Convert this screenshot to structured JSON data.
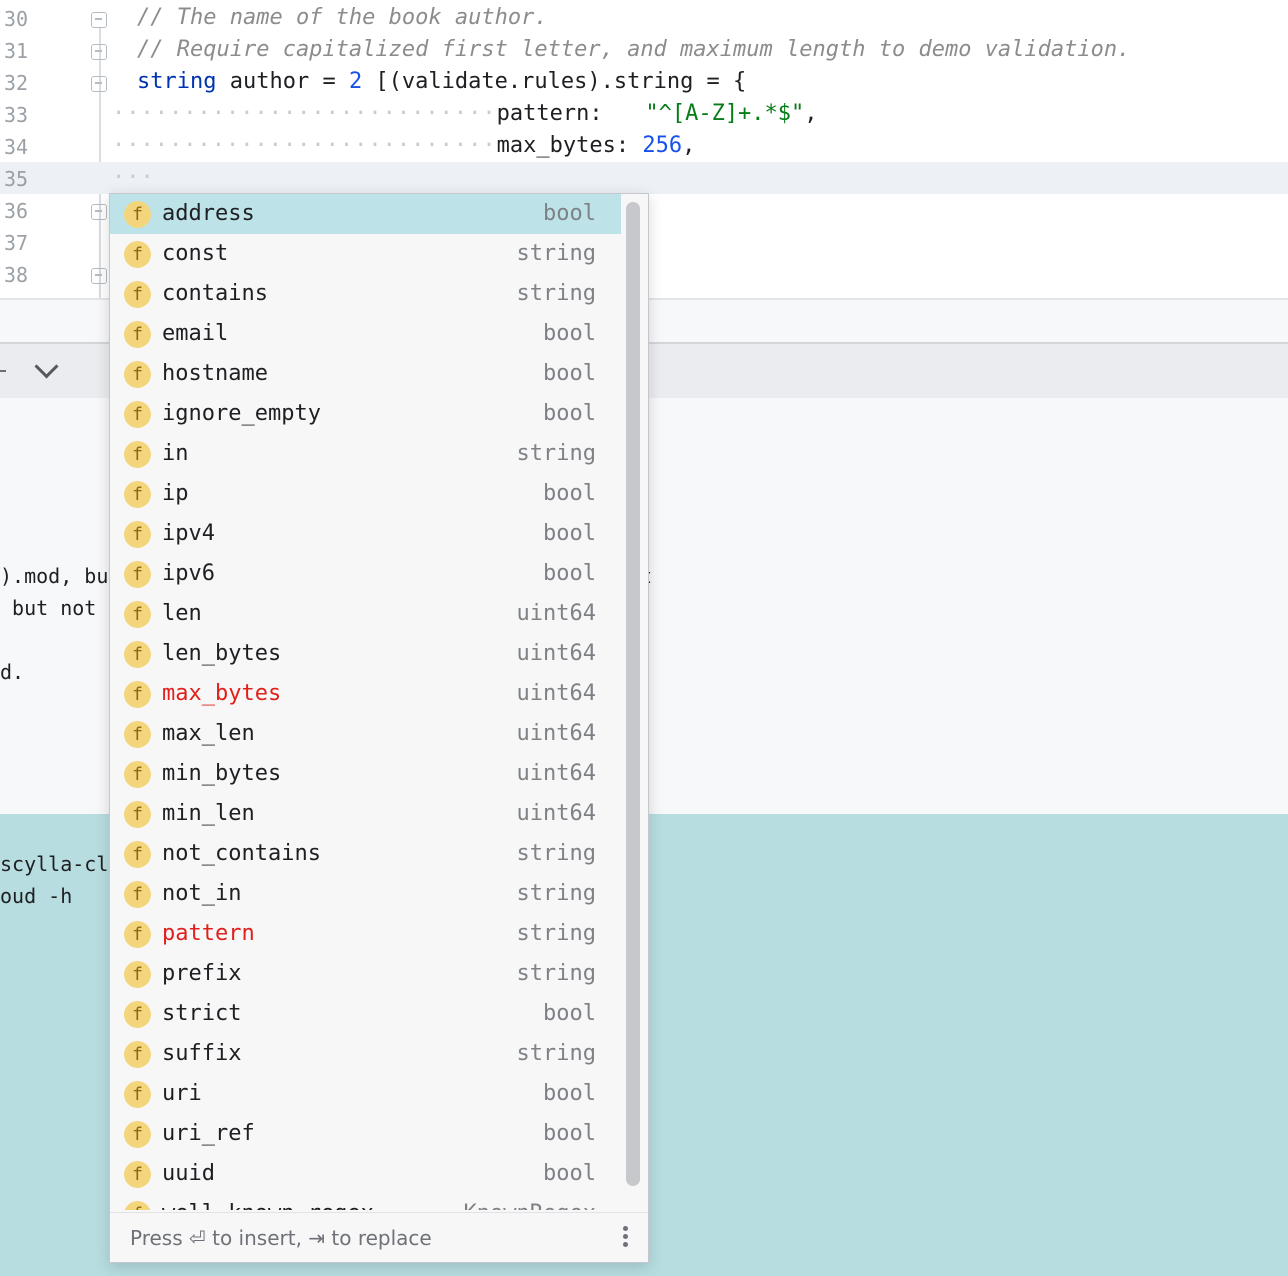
{
  "editor": {
    "lines": [
      {
        "num": "30",
        "comment": "// The name of the book author."
      },
      {
        "num": "31",
        "comment": "// Require capitalized first letter, and maximum length to demo validation."
      },
      {
        "num": "32",
        "kw": "string",
        "rest_a": " author = ",
        "n": "2",
        "rest_b": " [(validate.rules).string = {"
      },
      {
        "num": "33",
        "dots": "···························",
        "key": "pattern:",
        "pad": "   ",
        "str": "\"^[A-Z]+.*$\"",
        "tail": ","
      },
      {
        "num": "34",
        "dots": "···························",
        "key": "max_bytes: ",
        "n": "256",
        "tail": ","
      },
      {
        "num": "35",
        "dots": "···"
      },
      {
        "num": "36"
      },
      {
        "num": "37"
      },
      {
        "num": "38"
      }
    ]
  },
  "output": {
    "line1": ").mod, but",
    "line1_tail": "t",
    "line2": " but not m",
    "line3": "d."
  },
  "terminal": {
    "line1": "scylla-clo",
    "line2": "oud -h"
  },
  "completion": {
    "icon_letter": "f",
    "items": [
      {
        "name": "address",
        "type": "bool"
      },
      {
        "name": "const",
        "type": "string"
      },
      {
        "name": "contains",
        "type": "string"
      },
      {
        "name": "email",
        "type": "bool"
      },
      {
        "name": "hostname",
        "type": "bool"
      },
      {
        "name": "ignore_empty",
        "type": "bool"
      },
      {
        "name": "in",
        "type": "string"
      },
      {
        "name": "ip",
        "type": "bool"
      },
      {
        "name": "ipv4",
        "type": "bool"
      },
      {
        "name": "ipv6",
        "type": "bool"
      },
      {
        "name": "len",
        "type": "uint64"
      },
      {
        "name": "len_bytes",
        "type": "uint64"
      },
      {
        "name": "max_bytes",
        "type": "uint64"
      },
      {
        "name": "max_len",
        "type": "uint64"
      },
      {
        "name": "min_bytes",
        "type": "uint64"
      },
      {
        "name": "min_len",
        "type": "uint64"
      },
      {
        "name": "not_contains",
        "type": "string"
      },
      {
        "name": "not_in",
        "type": "string"
      },
      {
        "name": "pattern",
        "type": "string"
      },
      {
        "name": "prefix",
        "type": "string"
      },
      {
        "name": "strict",
        "type": "bool"
      },
      {
        "name": "suffix",
        "type": "string"
      },
      {
        "name": "uri",
        "type": "bool"
      },
      {
        "name": "uri_ref",
        "type": "bool"
      },
      {
        "name": "uuid",
        "type": "bool"
      },
      {
        "name": "well_known_regex",
        "type": "KnownRegex"
      }
    ],
    "footer_hint": "Press ⏎ to insert, ⇥ to replace",
    "colors": {
      "selected": "#bde3e8",
      "already_used": "#e0201c"
    }
  }
}
